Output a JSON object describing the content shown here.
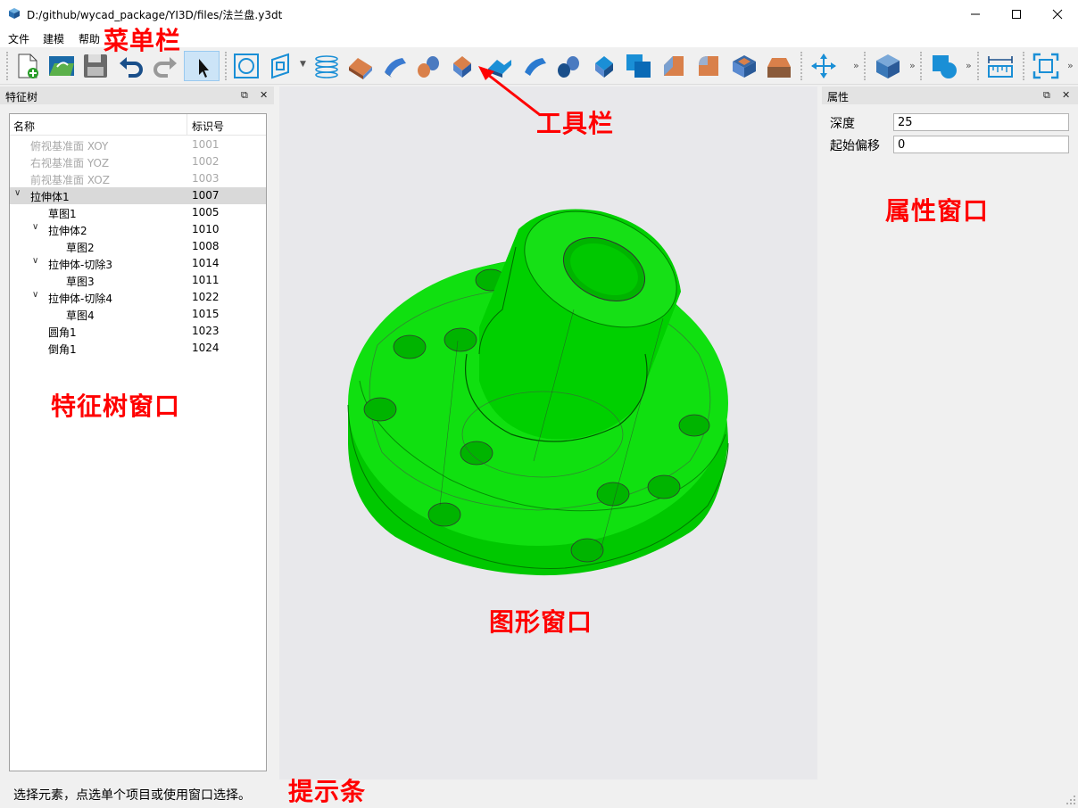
{
  "window": {
    "title": "D:/github/wycad_package/YI3D/files/法兰盘.y3dt",
    "minimize_icon": "minimize-icon",
    "maximize_icon": "maximize-icon",
    "close_icon": "close-icon"
  },
  "menu": {
    "items": [
      "文件",
      "建模",
      "帮助"
    ]
  },
  "toolbar": {
    "tools": [
      "new-document",
      "open-file",
      "save",
      "undo",
      "redo",
      "select",
      "circle-sketch",
      "plane-sketch",
      "helix",
      "extrude",
      "revolve",
      "sweep",
      "extrude-cut",
      "revolve-cut",
      "sweep-cut",
      "loft",
      "loft-cut",
      "boolean",
      "chamfer",
      "fillet",
      "shell",
      "draft",
      "move",
      "box",
      "shape",
      "measure",
      "fit-view"
    ],
    "more_label": "»"
  },
  "feature_tree": {
    "title": "特征树",
    "col_name": "名称",
    "col_id": "标识号",
    "rows": [
      {
        "name": "俯视基准面 XOY",
        "id": "1001"
      },
      {
        "name": "右视基准面 YOZ",
        "id": "1002"
      },
      {
        "name": "前视基准面 XOZ",
        "id": "1003"
      },
      {
        "name": "拉伸体1",
        "id": "1007"
      },
      {
        "name": "草图1",
        "id": "1005"
      },
      {
        "name": "拉伸体2",
        "id": "1010"
      },
      {
        "name": "草图2",
        "id": "1008"
      },
      {
        "name": "拉伸体-切除3",
        "id": "1014"
      },
      {
        "name": "草图3",
        "id": "1011"
      },
      {
        "name": "拉伸体-切除4",
        "id": "1022"
      },
      {
        "name": "草图4",
        "id": "1015"
      },
      {
        "name": "圆角1",
        "id": "1023"
      },
      {
        "name": "倒角1",
        "id": "1024"
      }
    ]
  },
  "properties": {
    "title": "属性",
    "depth_label": "深度",
    "depth_value": "25",
    "offset_label": "起始偏移",
    "offset_value": "0"
  },
  "status": {
    "text": "选择元素，点选单个项目或使用窗口选择。"
  },
  "annotations": {
    "menubar": "菜单栏",
    "toolbar": "工具栏",
    "feature_tree": "特征树窗口",
    "properties": "属性窗口",
    "viewport": "图形窗口",
    "statusbar": "提示条"
  },
  "colors": {
    "model_green": "#00cc00",
    "annotation_red": "#ff0000",
    "accent_blue": "#1a8fd6"
  }
}
